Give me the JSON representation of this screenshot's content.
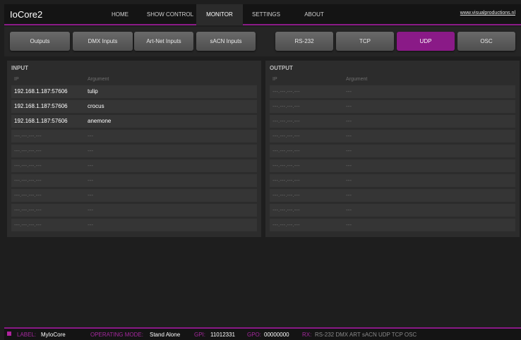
{
  "app": {
    "title": "IoCore2"
  },
  "nav": {
    "items": [
      {
        "label": "HOME"
      },
      {
        "label": "SHOW CONTROL"
      },
      {
        "label": "MONITOR",
        "active": true
      },
      {
        "label": "SETTINGS"
      },
      {
        "label": "ABOUT"
      }
    ],
    "site_link": "www.visualproductions.nl"
  },
  "tabs": [
    {
      "label": "Outputs"
    },
    {
      "label": "DMX Inputs"
    },
    {
      "label": "Art-Net Inputs"
    },
    {
      "label": "sACN Inputs"
    },
    {
      "label": "RS-232"
    },
    {
      "label": "TCP"
    },
    {
      "label": "UDP",
      "active": true
    },
    {
      "label": "OSC"
    }
  ],
  "input_panel": {
    "title": "INPUT",
    "col_ip": "IP",
    "col_arg": "Argument",
    "rows": [
      {
        "ip": "192.168.1.187:57606",
        "arg": "tulip"
      },
      {
        "ip": "192.168.1.187:57606",
        "arg": "crocus"
      },
      {
        "ip": "192.168.1.187:57606",
        "arg": "anemone"
      },
      {
        "ip": "---.---.---.---",
        "arg": "---"
      },
      {
        "ip": "---.---.---.---",
        "arg": "---"
      },
      {
        "ip": "---.---.---.---",
        "arg": "---"
      },
      {
        "ip": "---.---.---.---",
        "arg": "---"
      },
      {
        "ip": "---.---.---.---",
        "arg": "---"
      },
      {
        "ip": "---.---.---.---",
        "arg": "---"
      },
      {
        "ip": "---.---.---.---",
        "arg": "---"
      }
    ]
  },
  "output_panel": {
    "title": "OUTPUT",
    "col_ip": "IP",
    "col_arg": "Argument",
    "rows": [
      {
        "ip": "---.---.---.---",
        "arg": "---"
      },
      {
        "ip": "---.---.---.---",
        "arg": "---"
      },
      {
        "ip": "---.---.---.---",
        "arg": "---"
      },
      {
        "ip": "---.---.---.---",
        "arg": "---"
      },
      {
        "ip": "---.---.---.---",
        "arg": "---"
      },
      {
        "ip": "---.---.---.---",
        "arg": "---"
      },
      {
        "ip": "---.---.---.---",
        "arg": "---"
      },
      {
        "ip": "---.---.---.---",
        "arg": "---"
      },
      {
        "ip": "---.---.---.---",
        "arg": "---"
      },
      {
        "ip": "---.---.---.---",
        "arg": "---"
      }
    ]
  },
  "status": {
    "label_key": "LABEL:",
    "label_value": "MyIoCore",
    "mode_key": "OPERATING MODE:",
    "mode_value": "Stand Alone",
    "gpi_key": "GPI:",
    "gpi_value": "11012331",
    "gpo_key": "GPO:",
    "gpo_value": "00000000",
    "rx_key": "RX:",
    "rx_value": "RS-232 DMX ART sACN UDP TCP OSC"
  },
  "colors": {
    "accent": "#8a1a87",
    "background": "#1e1e1e",
    "panel": "#2c2c2c"
  }
}
